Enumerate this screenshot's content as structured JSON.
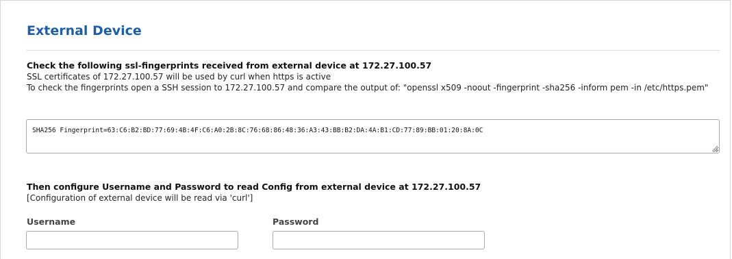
{
  "page": {
    "title": "External Device"
  },
  "ssl_section": {
    "heading": "Check the following ssl-fingerprints received from external device at 172.27.100.57",
    "line1": "SSL certificates of 172.27.100.57 will be used by curl when https is active",
    "line2": "To check the fingerprints open a SSH session to 172.27.100.57 and compare the output of: \"openssl x509 -noout -fingerprint -sha256 -inform pem -in /etc/https.pem\"",
    "fingerprint_value": "SHA256 Fingerprint=63:C6:B2:BD:77:69:4B:4F:C6:A0:2B:8C:76:68:86:48:36:A3:43:BB:B2:DA:4A:B1:CD:77:89:BB:01:20:8A:0C"
  },
  "credentials_section": {
    "heading": "Then configure Username and Password to read Config from external device at 172.27.100.57",
    "note": "[Configuration of external device will be read via 'curl']",
    "username_label": "Username",
    "username_value": "",
    "password_label": "Password",
    "password_value": ""
  }
}
